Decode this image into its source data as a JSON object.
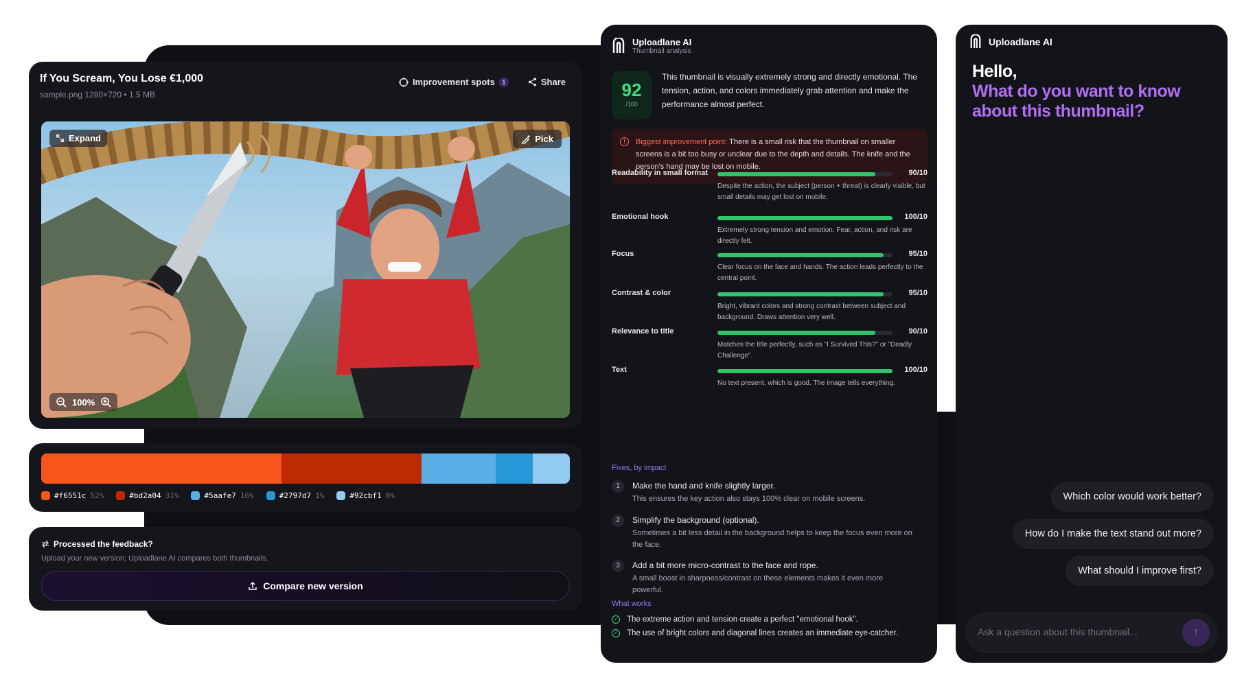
{
  "thumbnail": {
    "title": "If You Scream, You Lose €1,000",
    "file_info": "sample.png   1280×720 • 1.5 MB",
    "improvement_label": "Improvement spots",
    "improvement_count": "1",
    "share_label": "Share",
    "expand_label": "Expand",
    "pick_label": "Pick",
    "zoom": "100%"
  },
  "palette": [
    {
      "hex": "#f6551c",
      "pct": "52%",
      "fraction": 0.52
    },
    {
      "hex": "#bd2a04",
      "pct": "31%",
      "fraction": 0.31
    },
    {
      "hex": "#5aafe7",
      "pct": "16%",
      "fraction": 0.16
    },
    {
      "hex": "#2797d7",
      "pct": "1%",
      "fraction": 0.01
    },
    {
      "hex": "#92cbf1",
      "pct": "0%",
      "fraction": 0.0
    }
  ],
  "feedback": {
    "title": "Processed the feedback?",
    "subtitle": "Upload your new version; Uploadlane AI compares both thumbnails.",
    "button": "Compare new version"
  },
  "analysis": {
    "brand": "Uploadlane AI",
    "brand_sub": "Thumbnail analysis",
    "score": "92",
    "score_denom": "/100",
    "summary": "This thumbnail is visually extremely strong and directly emotional. The tension, action, and colors immediately grab attention and make the performance almost perfect.",
    "warning_label": "Biggest improvement point:",
    "warning_text": " There is a small risk that the thumbnail on smaller screens is a bit too busy or unclear due to the depth and details. The knife and the person's hand may be lost on mobile.",
    "metrics": [
      {
        "label": "Readability in small format",
        "score": "90/10",
        "value": 0.9,
        "desc": "Despite the action, the subject (person + threat) is clearly visible, but small details may get lost on mobile."
      },
      {
        "label": "Emotional hook",
        "score": "100/10",
        "value": 1.0,
        "desc": "Extremely strong tension and emotion. Fear, action, and risk are directly felt."
      },
      {
        "label": "Focus",
        "score": "95/10",
        "value": 0.95,
        "desc": "Clear focus on the face and hands. The action leads perfectly to the central point."
      },
      {
        "label": "Contrast & color",
        "score": "95/10",
        "value": 0.95,
        "desc": "Bright, vibrant colors and strong contrast between subject and background. Draws attention very well."
      },
      {
        "label": "Relevance to title",
        "score": "90/10",
        "value": 0.9,
        "desc": "Matches the title perfectly, such as \"I Survived This?\" or \"Deadly Challenge\"."
      },
      {
        "label": "Text",
        "score": "100/10",
        "value": 1.0,
        "desc": "No text present, which is good. The image tells everything."
      }
    ],
    "fixes_heading": "Fixes, by impact",
    "fixes": [
      {
        "num": "1",
        "title": "Make the hand and knife slightly larger.",
        "desc": "This ensures the key action also stays 100% clear on mobile screens."
      },
      {
        "num": "2",
        "title": "Simplify the background (optional).",
        "desc": "Sometimes a bit less detail in the background helps to keep the focus even more on the face."
      },
      {
        "num": "3",
        "title": "Add a bit more micro-contrast to the face and rope.",
        "desc": "A small boost in sharpness/contrast on these elements makes it even more powerful."
      }
    ],
    "works_heading": "What works",
    "works": [
      "The extreme action and tension create a perfect \"emotional hook\".",
      "The use of bright colors and diagonal lines creates an immediate eye-catcher."
    ]
  },
  "chat": {
    "brand": "Uploadlane AI",
    "hello": "Hello,",
    "question": "What do you want to know about this thumbnail?",
    "suggestions": [
      "Which color would work better?",
      "How do I make the text stand out more?",
      "What should I improve first?"
    ],
    "input_placeholder": "Ask a question about this thumbnail..."
  }
}
